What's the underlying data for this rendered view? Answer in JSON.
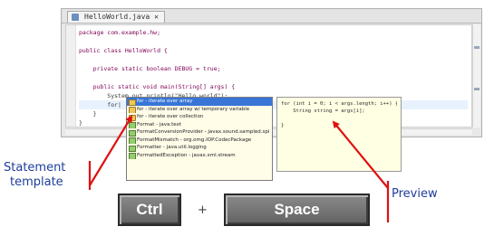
{
  "editor": {
    "tab_label": "HelloWorld.java ✕",
    "lines": [
      "package com.example.hw;",
      "",
      "public class HelloWorld {",
      "",
      "    private static boolean DEBUG = true;",
      "",
      "    public static void main(String[] args) {",
      "        System.out.println(\"Hello world\");",
      "        for|",
      "    }",
      "}"
    ]
  },
  "completion": {
    "items": [
      "for - iterate over array",
      "for - iterate over array w/ temporary variable",
      "for - iterate over collection",
      "Format - java.text",
      "FormatConversionProvider - javax.sound.sampled.spi",
      "FormatMismatch - org.omg.IOP.CodecPackage",
      "Formatter - java.util.logging",
      "FormattedException - javax.xml.stream"
    ],
    "selected_index": 0
  },
  "preview": {
    "lines": [
      "for (int i = 0; i < args.length; i++) {",
      "    String string = args[i];",
      "",
      "}"
    ]
  },
  "callouts": {
    "statement_line1": "Statement",
    "statement_line2": "template",
    "preview": "Preview",
    "plus": "+"
  },
  "keys": {
    "ctrl": "Ctrl",
    "space": "Space"
  },
  "colors": {
    "arrow": "#e01010",
    "caption": "#1d3d9a",
    "selection": "#3875d7"
  }
}
